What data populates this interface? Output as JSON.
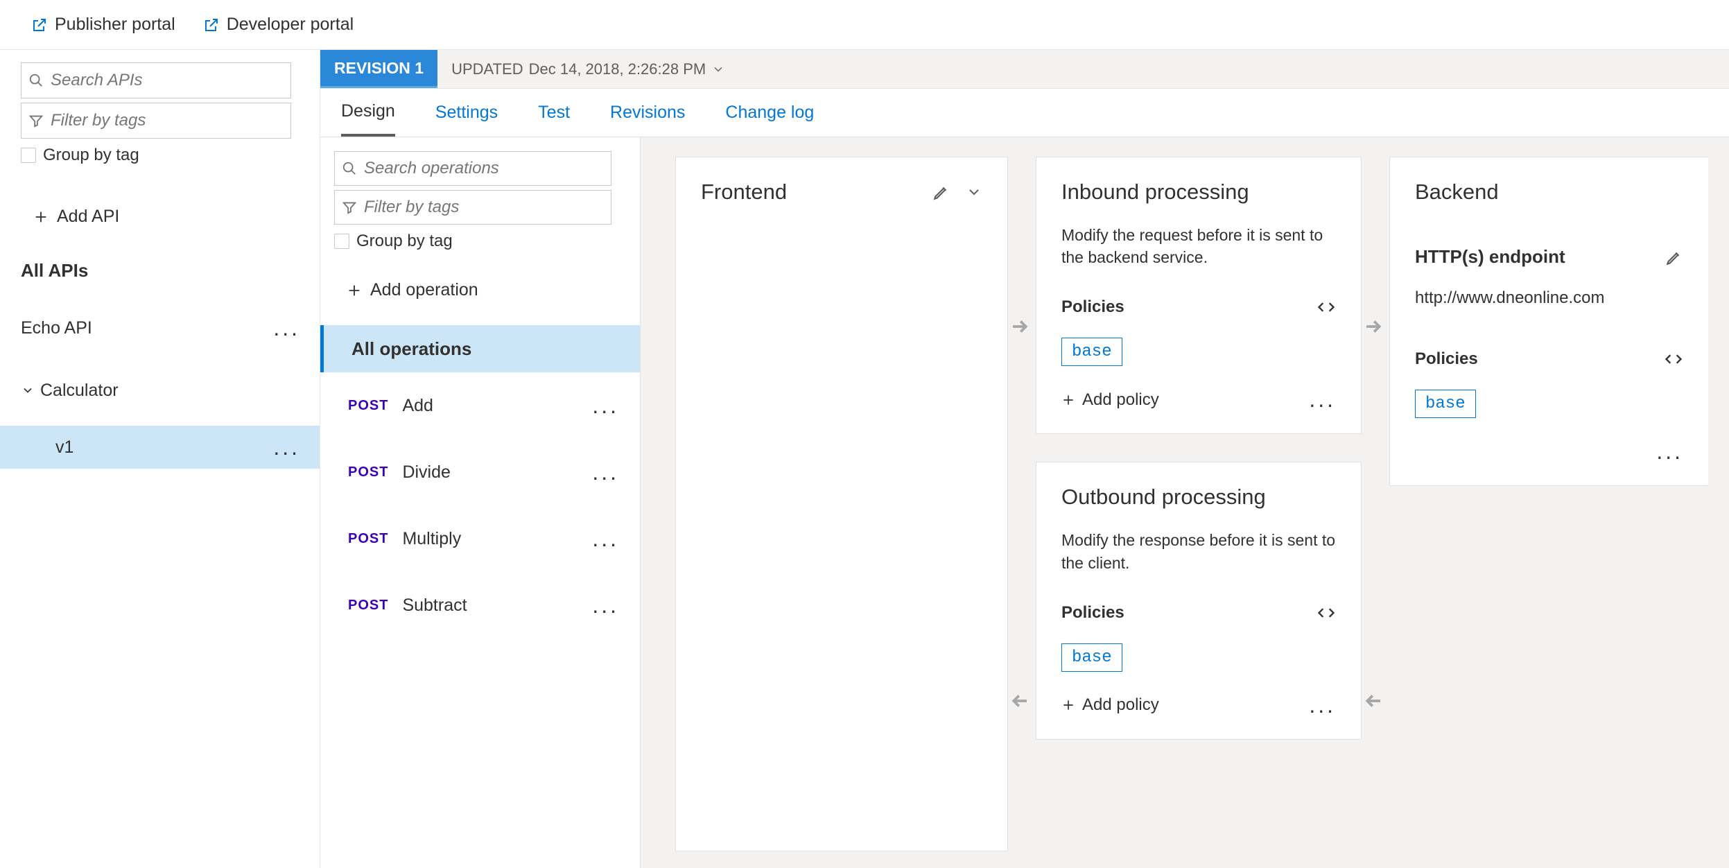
{
  "topbar": {
    "publisher": "Publisher portal",
    "developer": "Developer portal"
  },
  "sidebar": {
    "search_placeholder": "Search APIs",
    "filter_placeholder": "Filter by tags",
    "group_by_tag": "Group by tag",
    "add_api": "Add API",
    "all_apis": "All APIs",
    "apis": [
      "Echo API",
      "Calculator"
    ],
    "selected_version": "v1"
  },
  "revbar": {
    "revision": "REVISION 1",
    "updated_label": "UPDATED",
    "updated_time": "Dec 14, 2018, 2:26:28 PM"
  },
  "tabs": [
    "Design",
    "Settings",
    "Test",
    "Revisions",
    "Change log"
  ],
  "active_tab": "Design",
  "ops": {
    "search_placeholder": "Search operations",
    "filter_placeholder": "Filter by tags",
    "group_by_tag": "Group by tag",
    "add_op": "Add operation",
    "all_ops": "All operations",
    "items": [
      {
        "verb": "POST",
        "name": "Add"
      },
      {
        "verb": "POST",
        "name": "Divide"
      },
      {
        "verb": "POST",
        "name": "Multiply"
      },
      {
        "verb": "POST",
        "name": "Subtract"
      }
    ]
  },
  "frontend": {
    "title": "Frontend"
  },
  "inbound": {
    "title": "Inbound processing",
    "desc": "Modify the request before it is sent to the backend service.",
    "policies_label": "Policies",
    "base": "base",
    "add_policy": "Add policy"
  },
  "outbound": {
    "title": "Outbound processing",
    "desc": "Modify the response before it is sent to the client.",
    "policies_label": "Policies",
    "base": "base",
    "add_policy": "Add policy"
  },
  "backend": {
    "title": "Backend",
    "http_label": "HTTP(s) endpoint",
    "url": "http://www.dneonline.com",
    "policies_label": "Policies",
    "base": "base"
  }
}
